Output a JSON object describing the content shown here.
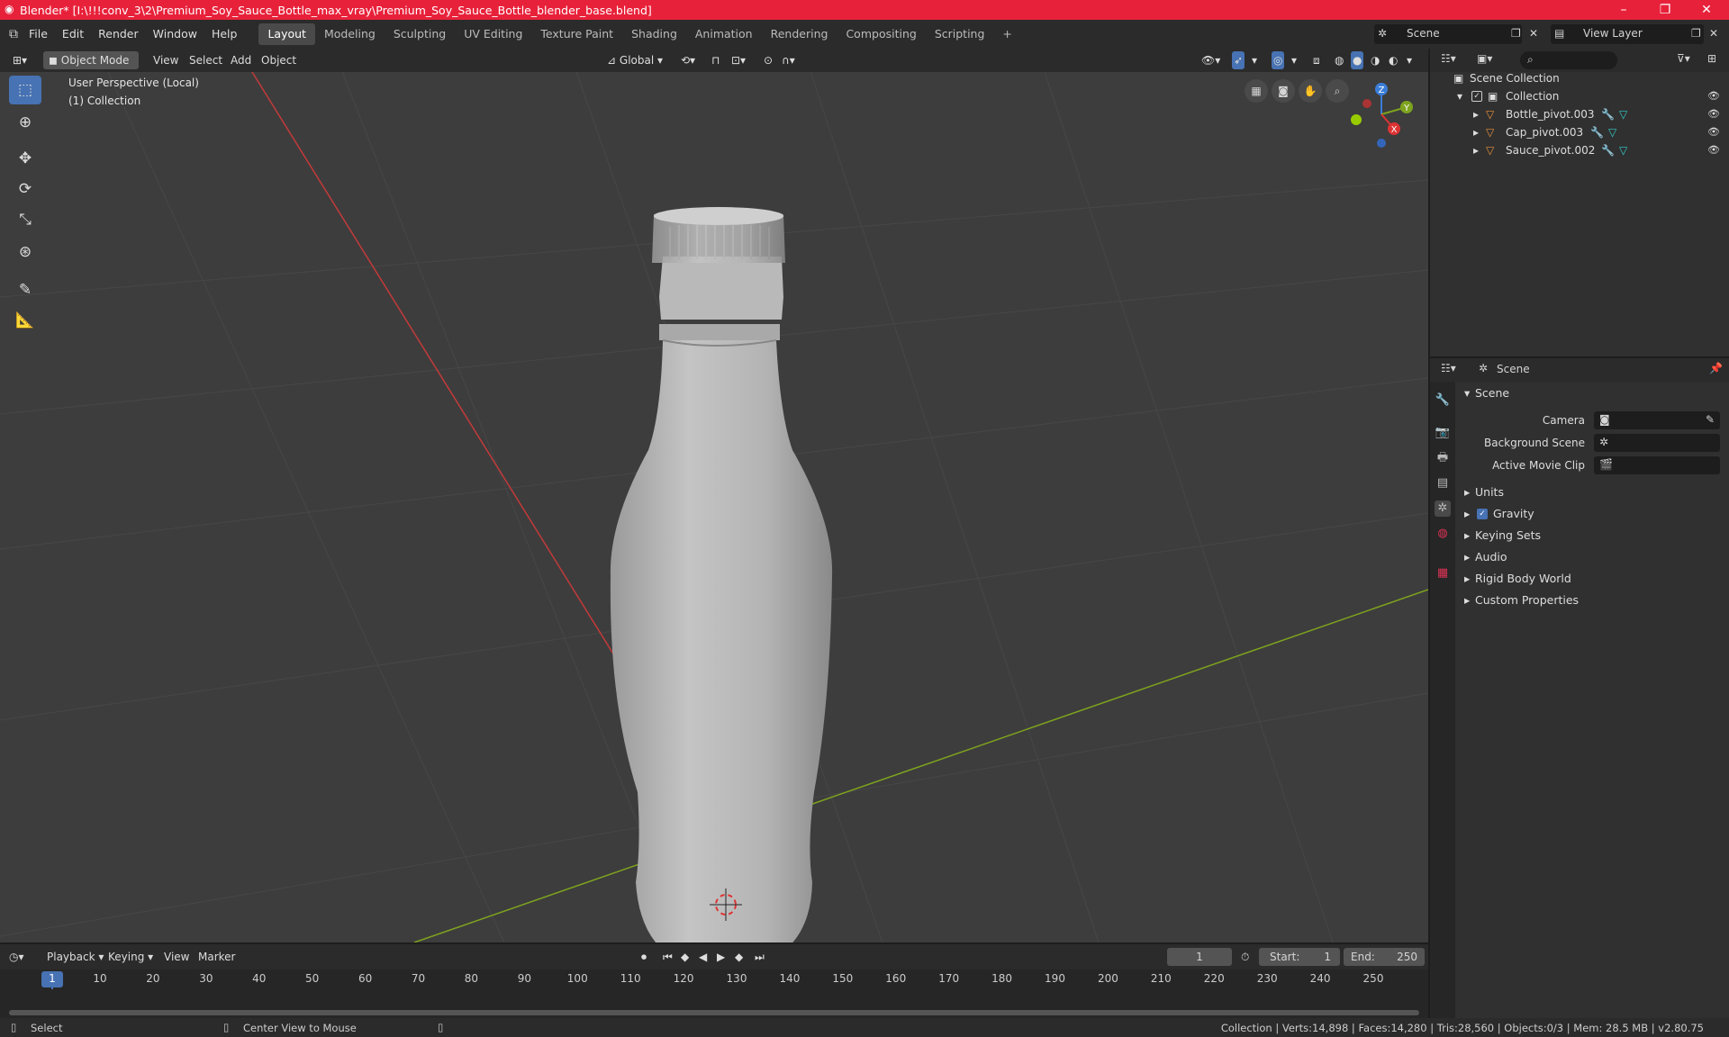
{
  "window": {
    "title": "Blender* [I:\\!!!conv_3\\2\\Premium_Soy_Sauce_Bottle_max_vray\\Premium_Soy_Sauce_Bottle_blender_base.blend]",
    "minimize": "–",
    "maximize": "❐",
    "close": "✕"
  },
  "menu": {
    "items": [
      "File",
      "Edit",
      "Render",
      "Window",
      "Help"
    ]
  },
  "workspaces": [
    "Layout",
    "Modeling",
    "Sculpting",
    "UV Editing",
    "Texture Paint",
    "Shading",
    "Animation",
    "Rendering",
    "Compositing",
    "Scripting"
  ],
  "scene_selector": {
    "value": "Scene"
  },
  "view_layer": {
    "value": "View Layer"
  },
  "viewport_header": {
    "mode": "Object Mode",
    "view": "View",
    "select": "Select",
    "add": "Add",
    "object": "Object",
    "orientation": "Global"
  },
  "viewport": {
    "perspective": "User Perspective (Local)",
    "collection": "(1) Collection"
  },
  "gizmo": {
    "x": "X",
    "y": "Y",
    "z": "Z"
  },
  "outliner": {
    "scene_collection": "Scene Collection",
    "collection": "Collection",
    "objects": [
      "Bottle_pivot.003",
      "Cap_pivot.003",
      "Sauce_pivot.002"
    ]
  },
  "properties": {
    "context": "Scene",
    "panel_title": "Scene",
    "camera_label": "Camera",
    "background_label": "Background Scene",
    "movieclip_label": "Active Movie Clip",
    "sections": [
      "Units",
      "Gravity",
      "Keying Sets",
      "Audio",
      "Rigid Body World",
      "Custom Properties"
    ],
    "gravity_checked": true
  },
  "timeline": {
    "playback": "Playback",
    "keying": "Keying",
    "view": "View",
    "marker": "Marker",
    "current_frame": "1",
    "start_label": "Start:",
    "start": "1",
    "end_label": "End:",
    "end": "250",
    "ticks": [
      "1",
      "10",
      "20",
      "30",
      "40",
      "50",
      "60",
      "70",
      "80",
      "90",
      "100",
      "110",
      "120",
      "130",
      "140",
      "150",
      "160",
      "170",
      "180",
      "190",
      "200",
      "210",
      "220",
      "230",
      "240",
      "250"
    ]
  },
  "statusbar": {
    "select": "Select",
    "center": "Center View to Mouse",
    "stats": "Collection | Verts:14,898 | Faces:14,280 | Tris:28,560 | Objects:0/3 | Mem: 28.5 MB | v2.80.75"
  },
  "colors": {
    "title_red": "#e8213a",
    "accent_blue": "#4772b3",
    "axis_red": "#c33a3a",
    "axis_green": "#7ea31e"
  }
}
